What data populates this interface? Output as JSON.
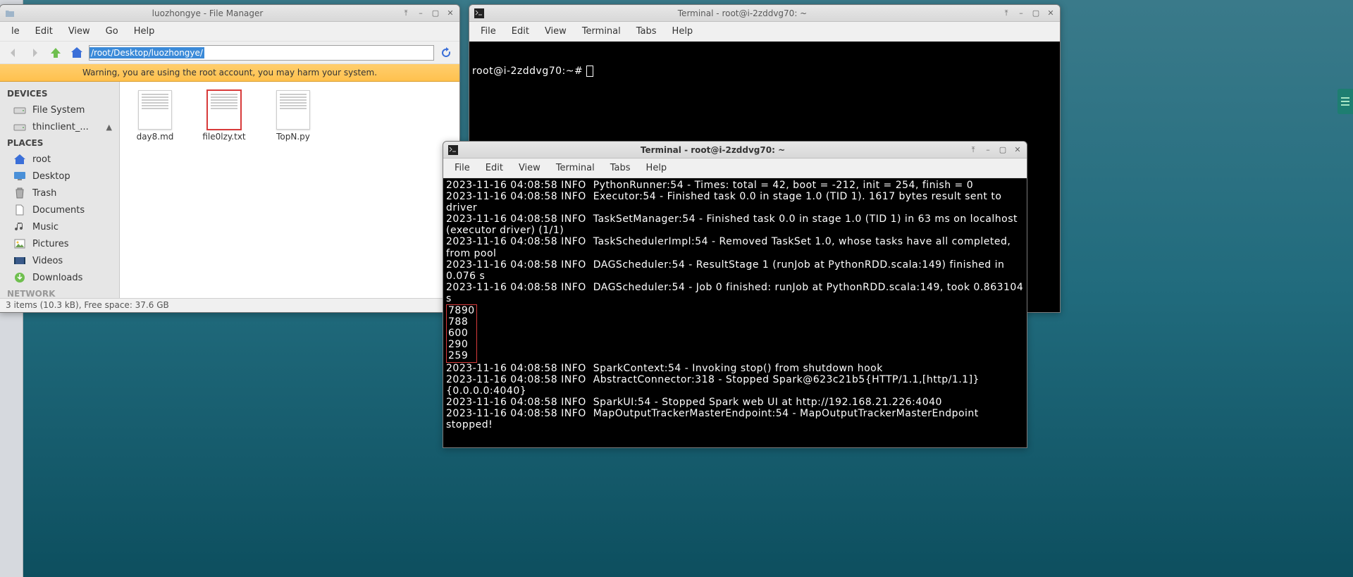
{
  "file_manager": {
    "title": "luozhongye - File Manager",
    "menu": {
      "file": "le",
      "edit": "Edit",
      "view": "View",
      "go": "Go",
      "help": "Help"
    },
    "path": "/root/Desktop/luozhongye/",
    "warning": "Warning, you are using the root account, you may harm your system.",
    "sidebar": {
      "devices_hdr": "DEVICES",
      "devices": [
        {
          "label": "File System"
        },
        {
          "label": "thinclient_..."
        }
      ],
      "places_hdr": "PLACES",
      "places": [
        {
          "label": "root"
        },
        {
          "label": "Desktop"
        },
        {
          "label": "Trash"
        },
        {
          "label": "Documents"
        },
        {
          "label": "Music"
        },
        {
          "label": "Pictures"
        },
        {
          "label": "Videos"
        },
        {
          "label": "Downloads"
        }
      ],
      "network_hdr": "NETWORK"
    },
    "files": [
      {
        "name": "day8.md"
      },
      {
        "name": "file0lzy.txt"
      },
      {
        "name": "TopN.py"
      }
    ],
    "status": "3 items (10.3 kB), Free space: 37.6 GB"
  },
  "terminal_back": {
    "title": "Terminal - root@i-2zddvg70: ~",
    "menu": {
      "file": "File",
      "edit": "Edit",
      "view": "View",
      "terminal": "Terminal",
      "tabs": "Tabs",
      "help": "Help"
    },
    "prompt": "root@i-2zddvg70:~# "
  },
  "terminal_front": {
    "title": "Terminal - root@i-2zddvg70: ~",
    "menu": {
      "file": "File",
      "edit": "Edit",
      "view": "View",
      "terminal": "Terminal",
      "tabs": "Tabs",
      "help": "Help"
    },
    "lines_before": "2023-11-16 04:08:58 INFO  PythonRunner:54 - Times: total = 42, boot = -212, init = 254, finish = 0\n2023-11-16 04:08:58 INFO  Executor:54 - Finished task 0.0 in stage 1.0 (TID 1). 1617 bytes result sent to driver\n2023-11-16 04:08:58 INFO  TaskSetManager:54 - Finished task 0.0 in stage 1.0 (TID 1) in 63 ms on localhost (executor driver) (1/1)\n2023-11-16 04:08:58 INFO  TaskSchedulerImpl:54 - Removed TaskSet 1.0, whose tasks have all completed, from pool\n2023-11-16 04:08:58 INFO  DAGScheduler:54 - ResultStage 1 (runJob at PythonRDD.scala:149) finished in 0.076 s\n2023-11-16 04:08:58 INFO  DAGScheduler:54 - Job 0 finished: runJob at PythonRDD.scala:149, took 0.863104 s",
    "highlight": "7890\n788\n600\n290\n259",
    "lines_after": "2023-11-16 04:08:58 INFO  SparkContext:54 - Invoking stop() from shutdown hook\n2023-11-16 04:08:58 INFO  AbstractConnector:318 - Stopped Spark@623c21b5{HTTP/1.1,[http/1.1]}{0.0.0.0:4040}\n2023-11-16 04:08:58 INFO  SparkUI:54 - Stopped Spark web UI at http://192.168.21.226:4040\n2023-11-16 04:08:58 INFO  MapOutputTrackerMasterEndpoint:54 - MapOutputTrackerMasterEndpoint stopped!"
  }
}
